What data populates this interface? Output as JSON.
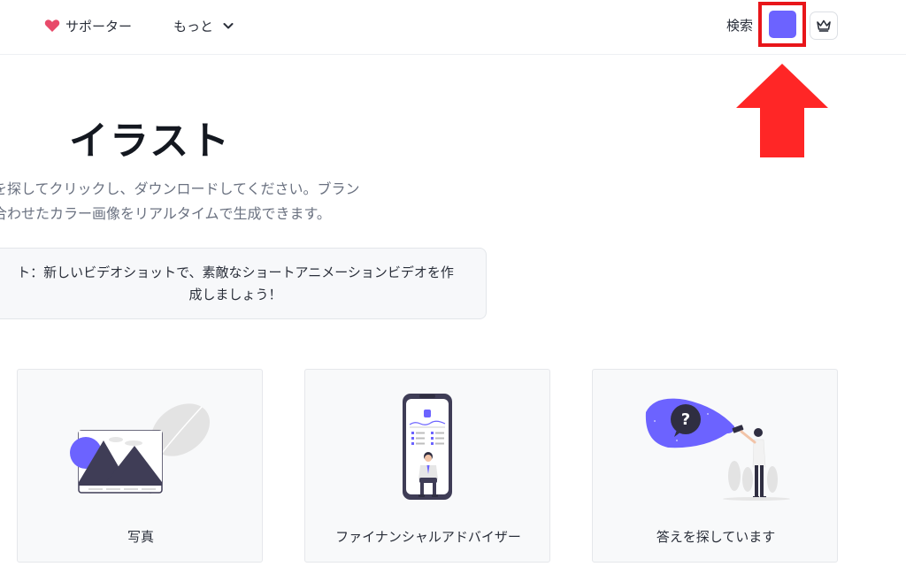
{
  "header": {
    "supporter_label": "サポーター",
    "more_label": "もっと",
    "search_label": "検索"
  },
  "colors": {
    "accent": "#6c63ff",
    "highlight_red": "#e8161a",
    "heart": "#e84a6a"
  },
  "icons": {
    "supporter": "heart-icon",
    "more": "chevron-down-icon",
    "premium": "crown-icon",
    "annotation": "red-up-arrow"
  },
  "hero": {
    "title": "イラスト",
    "description_line1": "を探してクリックし、ダウンロードしてください。ブラン",
    "description_line2": "合わせたカラー画像をリアルタイムで生成できます。",
    "notice_line1": "ト：新しいビデオショットで、素敵なショートアニメーションビデオを作",
    "notice_line2": "成しましょう！"
  },
  "cards": [
    {
      "label": "写真"
    },
    {
      "label": "ファイナンシャルアドバイザー"
    },
    {
      "label": "答えを探しています"
    }
  ]
}
